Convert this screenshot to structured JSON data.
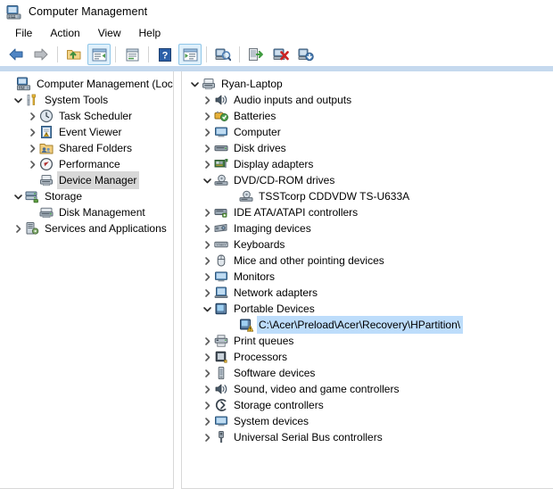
{
  "window": {
    "title": "Computer Management",
    "icon": "computer-management-icon"
  },
  "menu": {
    "items": [
      {
        "label": "File",
        "name": "menu-file"
      },
      {
        "label": "Action",
        "name": "menu-action"
      },
      {
        "label": "View",
        "name": "menu-view"
      },
      {
        "label": "Help",
        "name": "menu-help"
      }
    ]
  },
  "toolbar": {
    "buttons": [
      {
        "name": "back-button",
        "icon": "back-arrow-icon",
        "checked": false
      },
      {
        "name": "forward-button",
        "icon": "forward-arrow-icon",
        "checked": false
      },
      {
        "name": "up-one-level-button",
        "icon": "folder-up-icon",
        "checked": false
      },
      {
        "name": "show-hide-console-tree-button",
        "icon": "console-tree-icon",
        "checked": true
      },
      {
        "name": "properties-button",
        "icon": "properties-window-icon",
        "checked": false
      },
      {
        "name": "help-button",
        "icon": "question-mark-icon",
        "checked": false
      },
      {
        "name": "show-hide-action-pane-button",
        "icon": "action-pane-icon",
        "checked": true
      },
      {
        "name": "scan-for-hardware-changes-button",
        "icon": "scan-hardware-icon",
        "checked": false
      },
      {
        "name": "update-driver-button",
        "icon": "update-driver-icon",
        "checked": false
      },
      {
        "name": "uninstall-device-button",
        "icon": "uninstall-device-icon",
        "checked": false
      },
      {
        "name": "disable-device-button",
        "icon": "disable-device-icon",
        "checked": false
      }
    ]
  },
  "console_tree": {
    "root": {
      "label": "Computer Management (Local",
      "icon": "computer-management-icon",
      "expanded": true,
      "indent": 0
    },
    "items": [
      {
        "label": "System Tools",
        "icon": "system-tools-icon",
        "state": "expanded",
        "indent": 1,
        "name": "tree-item-system-tools"
      },
      {
        "label": "Task Scheduler",
        "icon": "task-scheduler-icon",
        "state": "collapsed",
        "indent": 2,
        "name": "tree-item-task-scheduler"
      },
      {
        "label": "Event Viewer",
        "icon": "event-viewer-icon",
        "state": "collapsed",
        "indent": 2,
        "name": "tree-item-event-viewer"
      },
      {
        "label": "Shared Folders",
        "icon": "shared-folders-icon",
        "state": "collapsed",
        "indent": 2,
        "name": "tree-item-shared-folders"
      },
      {
        "label": "Performance",
        "icon": "performance-icon",
        "state": "collapsed",
        "indent": 2,
        "name": "tree-item-performance"
      },
      {
        "label": "Device Manager",
        "icon": "device-manager-icon",
        "state": "leaf",
        "indent": 2,
        "selected": "gray",
        "name": "tree-item-device-manager"
      },
      {
        "label": "Storage",
        "icon": "storage-icon",
        "state": "expanded",
        "indent": 1,
        "name": "tree-item-storage"
      },
      {
        "label": "Disk Management",
        "icon": "disk-management-icon",
        "state": "leaf",
        "indent": 2,
        "name": "tree-item-disk-management"
      },
      {
        "label": "Services and Applications",
        "icon": "services-applications-icon",
        "state": "collapsed",
        "indent": 1,
        "name": "tree-item-services-and-applications"
      }
    ]
  },
  "device_tree": {
    "root": {
      "label": "Ryan-Laptop",
      "icon": "computer-root-icon",
      "state": "expanded",
      "indent": 0,
      "name": "device-root-ryan-laptop"
    },
    "items": [
      {
        "label": "Audio inputs and outputs",
        "icon": "speaker-icon",
        "state": "collapsed",
        "indent": 1,
        "name": "device-category-audio-inputs-and-outputs"
      },
      {
        "label": "Batteries",
        "icon": "battery-icon",
        "state": "collapsed",
        "indent": 1,
        "name": "device-category-batteries"
      },
      {
        "label": "Computer",
        "icon": "monitor-icon",
        "state": "collapsed",
        "indent": 1,
        "name": "device-category-computer"
      },
      {
        "label": "Disk drives",
        "icon": "disk-drive-icon",
        "state": "collapsed",
        "indent": 1,
        "name": "device-category-disk-drives"
      },
      {
        "label": "Display adapters",
        "icon": "display-adapter-icon",
        "state": "collapsed",
        "indent": 1,
        "name": "device-category-display-adapters"
      },
      {
        "label": "DVD/CD-ROM drives",
        "icon": "optical-drive-icon",
        "state": "expanded",
        "indent": 1,
        "name": "device-category-dvd-cd-rom-drives"
      },
      {
        "label": "TSSTcorp CDDVDW TS-U633A",
        "icon": "optical-disc-icon",
        "state": "leaf",
        "indent": 2,
        "name": "device-item-tsstcorp-cddvdw-ts-u633a"
      },
      {
        "label": "IDE ATA/ATAPI controllers",
        "icon": "ide-controller-icon",
        "state": "collapsed",
        "indent": 1,
        "name": "device-category-ide-ata-atapi-controllers"
      },
      {
        "label": "Imaging devices",
        "icon": "camera-icon",
        "state": "collapsed",
        "indent": 1,
        "name": "device-category-imaging-devices"
      },
      {
        "label": "Keyboards",
        "icon": "keyboard-icon",
        "state": "collapsed",
        "indent": 1,
        "name": "device-category-keyboards"
      },
      {
        "label": "Mice and other pointing devices",
        "icon": "mouse-icon",
        "state": "collapsed",
        "indent": 1,
        "name": "device-category-mice-and-other-pointing-devices"
      },
      {
        "label": "Monitors",
        "icon": "monitor-icon",
        "state": "collapsed",
        "indent": 1,
        "name": "device-category-monitors"
      },
      {
        "label": "Network adapters",
        "icon": "network-adapter-icon",
        "state": "collapsed",
        "indent": 1,
        "name": "device-category-network-adapters"
      },
      {
        "label": "Portable Devices",
        "icon": "portable-device-icon",
        "state": "expanded",
        "indent": 1,
        "name": "device-category-portable-devices"
      },
      {
        "label": "C:\\Acer\\Preload\\Acer\\Recovery\\HPartition\\",
        "icon": "portable-device-warning-icon",
        "state": "leaf",
        "indent": 2,
        "selected": "blue",
        "name": "device-item-acer-recovery-hpartition"
      },
      {
        "label": "Print queues",
        "icon": "printer-icon",
        "state": "collapsed",
        "indent": 1,
        "name": "device-category-print-queues"
      },
      {
        "label": "Processors",
        "icon": "processor-icon",
        "state": "collapsed",
        "indent": 1,
        "name": "device-category-processors"
      },
      {
        "label": "Software devices",
        "icon": "software-device-icon",
        "state": "collapsed",
        "indent": 1,
        "name": "device-category-software-devices"
      },
      {
        "label": "Sound, video and game controllers",
        "icon": "speaker-icon",
        "state": "collapsed",
        "indent": 1,
        "name": "device-category-sound-video-and-game-controllers"
      },
      {
        "label": "Storage controllers",
        "icon": "storage-controller-icon",
        "state": "collapsed",
        "indent": 1,
        "name": "device-category-storage-controllers"
      },
      {
        "label": "System devices",
        "icon": "monitor-icon",
        "state": "collapsed",
        "indent": 1,
        "name": "device-category-system-devices"
      },
      {
        "label": "Universal Serial Bus controllers",
        "icon": "usb-icon",
        "state": "collapsed",
        "indent": 1,
        "name": "device-category-universal-serial-bus-controllers"
      }
    ]
  },
  "colors": {
    "selection_blue": "#bdddfb",
    "selection_gray": "#d8d8d8",
    "banner": "#c5d9ee",
    "toolbar_checked": "#dff0fb"
  }
}
